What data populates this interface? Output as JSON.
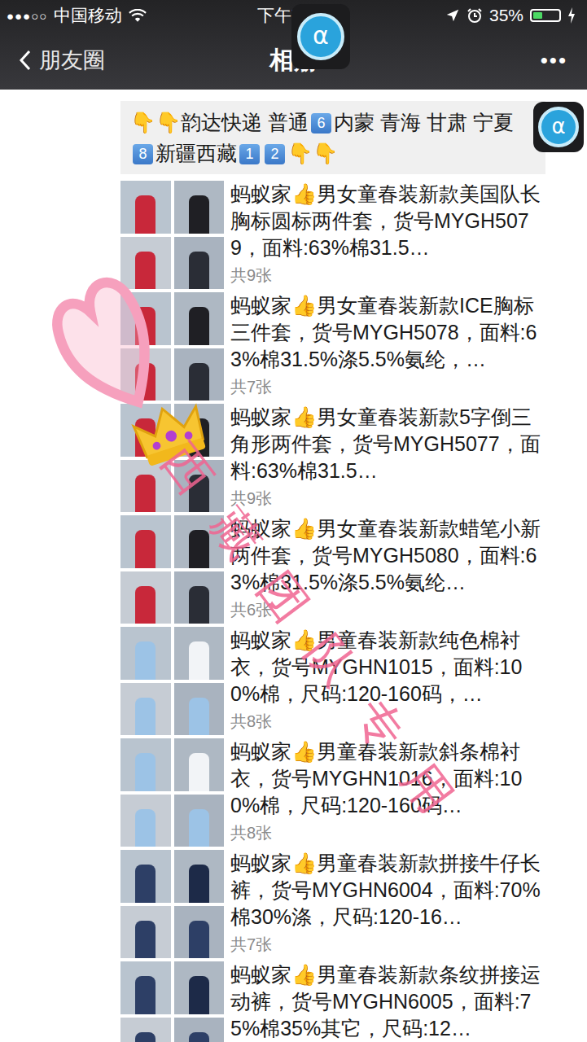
{
  "status_bar": {
    "signal": "●●●○○",
    "carrier": "中国移动",
    "time": "下午7:35",
    "battery": "35%",
    "battery_level": 0.35
  },
  "nav": {
    "back": "朋友圈",
    "title": "相册",
    "more": "•••"
  },
  "overlay_app": {
    "label": "α"
  },
  "banner": [
    {
      "kind": "text",
      "text": "👇👇韵达快递 普通"
    },
    {
      "kind": "keycap",
      "text": "6"
    },
    {
      "kind": "text",
      "text": "内蒙 青海 甘肃 宁夏"
    },
    {
      "kind": "keycap",
      "text": "8"
    },
    {
      "kind": "text",
      "text": "新疆西藏"
    },
    {
      "kind": "keycap",
      "text": "1"
    },
    {
      "kind": "keycap",
      "text": "2"
    },
    {
      "kind": "text",
      "text": "👇👇"
    }
  ],
  "posts": [
    {
      "text": "蚂蚁家👍男女童春装新款美国队长胸标圆标两件套，货号MYGH5079，面料:63%棉31.5…",
      "count": "共9张"
    },
    {
      "text": "蚂蚁家👍男女童春装新款ICE胸标三件套，货号MYGH5078，面料:63%棉31.5%涤5.5%氨纶，…",
      "count": "共7张"
    },
    {
      "text": "蚂蚁家👍男女童春装新款5字倒三角形两件套，货号MYGH5077，面料:63%棉31.5…",
      "count": "共9张"
    },
    {
      "text": "蚂蚁家👍男女童春装新款蜡笔小新两件套，货号MYGH5080，面料:63%棉31.5%涤5.5%氨纶…",
      "count": "共6张"
    },
    {
      "text": "蚂蚁家👍男童春装新款纯色棉衬衣，货号MYGHN1015，面料:100%棉，尺码:120-160码，…",
      "count": "共8张"
    },
    {
      "text": "蚂蚁家👍男童春装新款斜条棉衬衣，货号MYGHN1016，面料:100%棉，尺码:120-160码…",
      "count": "共8张"
    },
    {
      "text": "蚂蚁家👍男童春装新款拼接牛仔长裤，货号MYGHN6004，面料:70%棉30%涤，尺码:120-16…",
      "count": "共7张"
    },
    {
      "text": "蚂蚁家👍男童春装新款条纹拼接运动裤，货号MYGHN6005，面料:75%棉35%其它，尺码:12…",
      "count": ""
    }
  ],
  "watermark": {
    "text": "西藏团队专用"
  }
}
